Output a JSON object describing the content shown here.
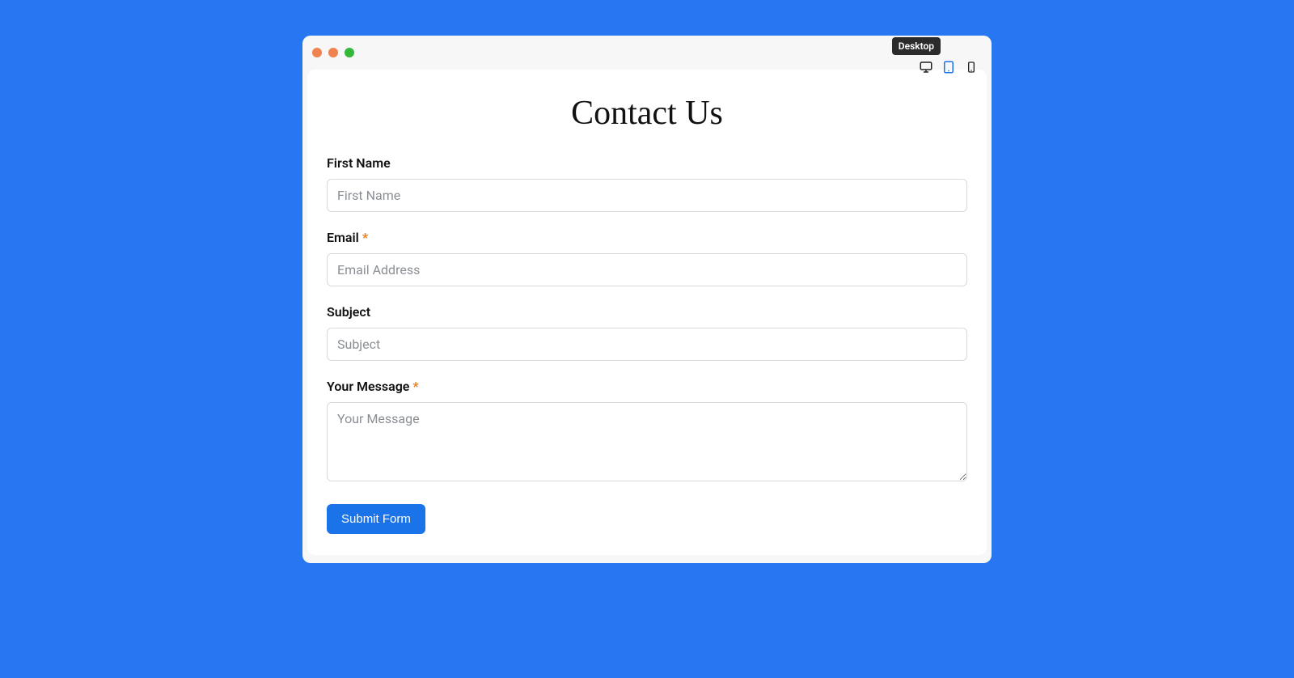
{
  "tooltip": "Desktop",
  "page_title": "Contact Us",
  "fields": {
    "first_name": {
      "label": "First Name",
      "placeholder": "First Name",
      "required": false
    },
    "email": {
      "label": "Email",
      "placeholder": "Email Address",
      "required": true
    },
    "subject": {
      "label": "Subject",
      "placeholder": "Subject",
      "required": false
    },
    "message": {
      "label": "Your Message",
      "placeholder": "Your Message",
      "required": true
    }
  },
  "required_marker": "*",
  "submit_label": "Submit Form"
}
